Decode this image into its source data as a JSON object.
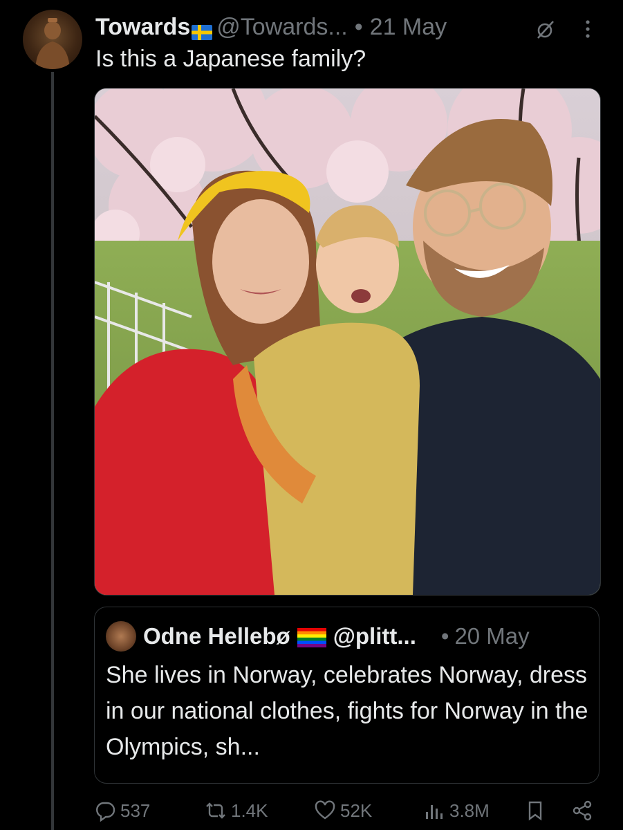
{
  "post": {
    "author_name": "Towards",
    "author_handle": "@Towards...",
    "separator": "•",
    "date": "21 May",
    "text": "Is this a Japanese family?",
    "icons": {
      "flag": "sweden-flag-icon",
      "grok": "grok-icon",
      "more": "more-options-icon"
    }
  },
  "quote": {
    "author_name": "Odne Hellebø",
    "author_handle": "@plitt...",
    "separator": "•",
    "date": "20 May",
    "text": "She lives in Norway, celebrates Norway, dress in our national clothes, fights for Norway in the Olympics, sh...",
    "icons": {
      "flag": "rainbow-flag-icon"
    }
  },
  "actions": {
    "replies": "537",
    "reposts": "1.4K",
    "likes": "52K",
    "views": "3.8M",
    "icons": [
      "reply-icon",
      "repost-icon",
      "like-icon",
      "views-icon",
      "bookmark-icon",
      "share-icon"
    ]
  },
  "colors": {
    "background": "#000000",
    "text": "#e7e9ea",
    "muted": "#71767b",
    "border": "#2f3336"
  }
}
